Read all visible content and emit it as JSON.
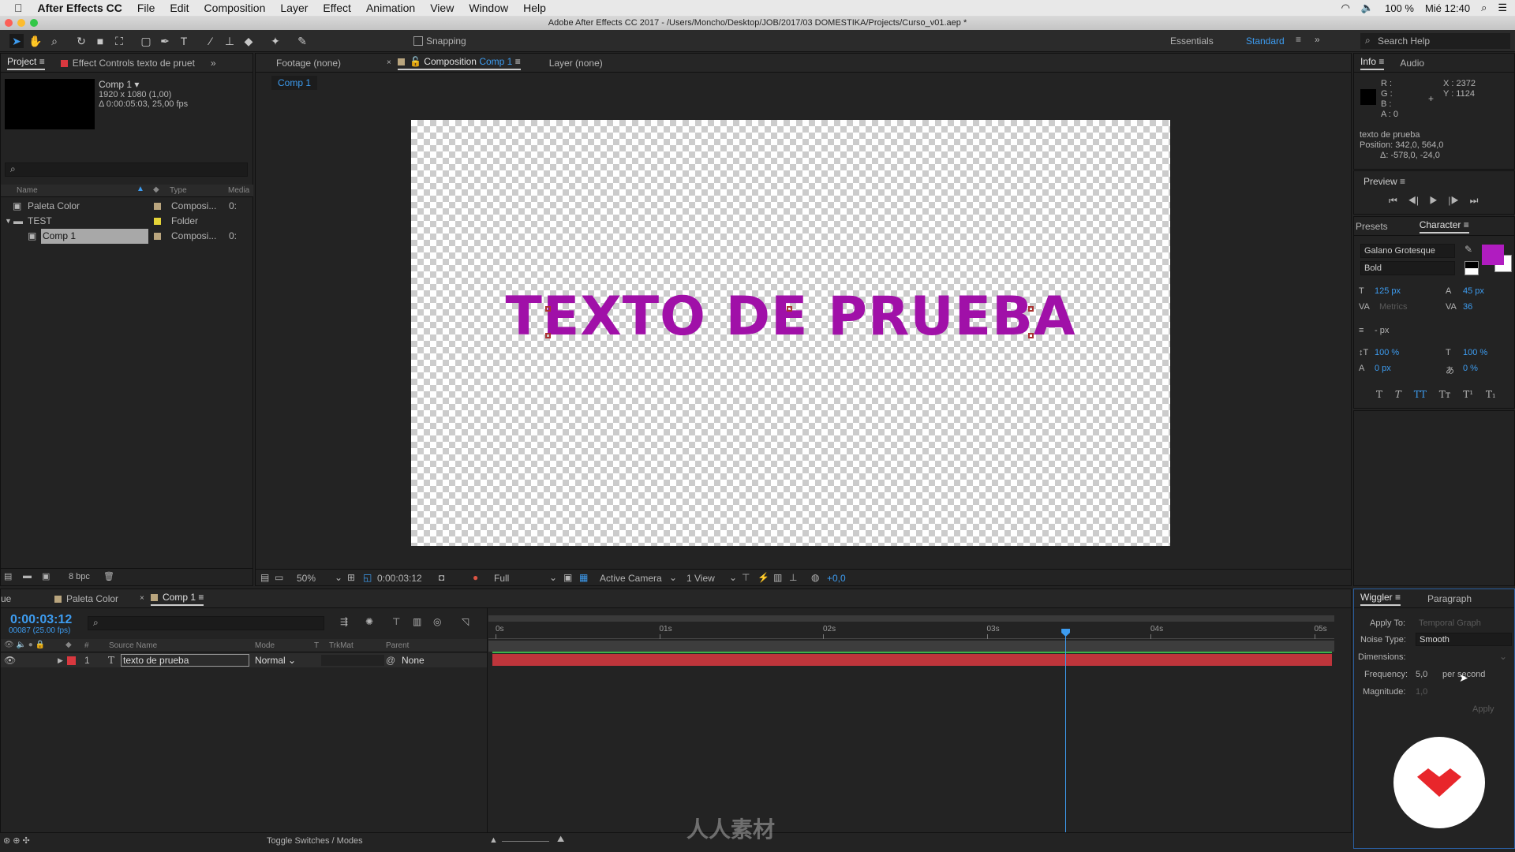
{
  "menubar": {
    "app": "After Effects CC",
    "items": [
      "File",
      "Edit",
      "Composition",
      "Layer",
      "Effect",
      "Animation",
      "View",
      "Window",
      "Help"
    ],
    "battery": "100 %",
    "clock": "Mié 12:40"
  },
  "titlebar": "Adobe After Effects CC 2017 - /Users/Moncho/Desktop/JOB/2017/03 DOMESTIKA/Projects/Curso_v01.aep *",
  "toolbar": {
    "snapping": "Snapping",
    "workspaces": [
      "Essentials",
      "Standard"
    ],
    "search_placeholder": "Search Help"
  },
  "project": {
    "tab": "Project",
    "effect_tab": "Effect Controls texto de pruet",
    "comp_name": "Comp 1 ▾",
    "comp_size": "1920 x 1080 (1,00)",
    "comp_duration": "Δ 0:00:05:03, 25,00 fps",
    "columns": [
      "Name",
      "Type",
      "Media"
    ],
    "items": [
      {
        "name": "Paleta Color",
        "type": "Composi...",
        "media": "0:",
        "color": "#b9a57e"
      },
      {
        "name": "TEST",
        "type": "Folder",
        "media": "",
        "color": "#e5d438"
      },
      {
        "name": "Comp 1",
        "type": "Composi...",
        "media": "0:",
        "color": "#b9a57e"
      }
    ],
    "bpc": "8 bpc"
  },
  "viewer": {
    "footage_tab": "Footage (none)",
    "comp_tab_prefix": "Composition",
    "comp_tab_name": "Comp 1",
    "layer_tab": "Layer (none)",
    "breadcrumb": "Comp 1",
    "text": "TEXTO DE PRUEBA",
    "text_color": "#a010a8",
    "zoom": "50%",
    "timecode": "0:00:03:12",
    "resolution": "Full",
    "camera": "Active Camera",
    "views": "1 View",
    "exposure": "+0,0"
  },
  "info": {
    "tab": "Info",
    "audio_tab": "Audio",
    "r": "R :",
    "g": "G :",
    "b": "B :",
    "a": "A : 0",
    "x": "X : 2372",
    "y": "Y : 1124",
    "layer": "texto de prueba",
    "position": "Position: 342,0, 564,0",
    "delta": "Δ: -578,0, -24,0"
  },
  "preview": {
    "tab": "Preview"
  },
  "character": {
    "presets_tab": "Presets",
    "tab": "Character",
    "font": "Galano Grotesque",
    "style": "Bold",
    "fill_color": "#b01cc0",
    "size": "125 px",
    "leading": "45 px",
    "kerning": "Metrics",
    "tracking": "36",
    "stroke": "- px",
    "vscale": "100 %",
    "hscale": "100 %",
    "baseline": "0 px",
    "tsume": "0 %",
    "styles": [
      "T",
      "T",
      "TT",
      "Tт",
      "T¹",
      "T₁"
    ]
  },
  "timeline": {
    "queue_tab": "ue",
    "tabs": [
      "Paleta Color",
      "Comp 1"
    ],
    "timecode": "0:00:03:12",
    "frames": "00087 (25.00 fps)",
    "columns": [
      "#",
      "Source Name",
      "Mode",
      "T",
      "TrkMat",
      "Parent"
    ],
    "layer": {
      "index": "1",
      "name": "texto de prueba",
      "mode": "Normal",
      "parent": "None"
    },
    "ruler": [
      "0s",
      "01s",
      "02s",
      "03s",
      "04s",
      "05s"
    ],
    "playhead_seconds": 3.48,
    "duration_seconds": 5.12,
    "toggle": "Toggle Switches / Modes"
  },
  "wiggler": {
    "tab": "Wiggler",
    "paragraph_tab": "Paragraph",
    "apply_to_label": "Apply To:",
    "apply_to": "Temporal Graph",
    "noise_label": "Noise Type:",
    "noise": "Smooth",
    "dimensions_label": "Dimensions:",
    "frequency_label": "Frequency:",
    "frequency": "5,0",
    "per_second": "per second",
    "magnitude_label": "Magnitude:",
    "magnitude": "1,0",
    "apply": "Apply"
  },
  "watermark": "人人素材"
}
